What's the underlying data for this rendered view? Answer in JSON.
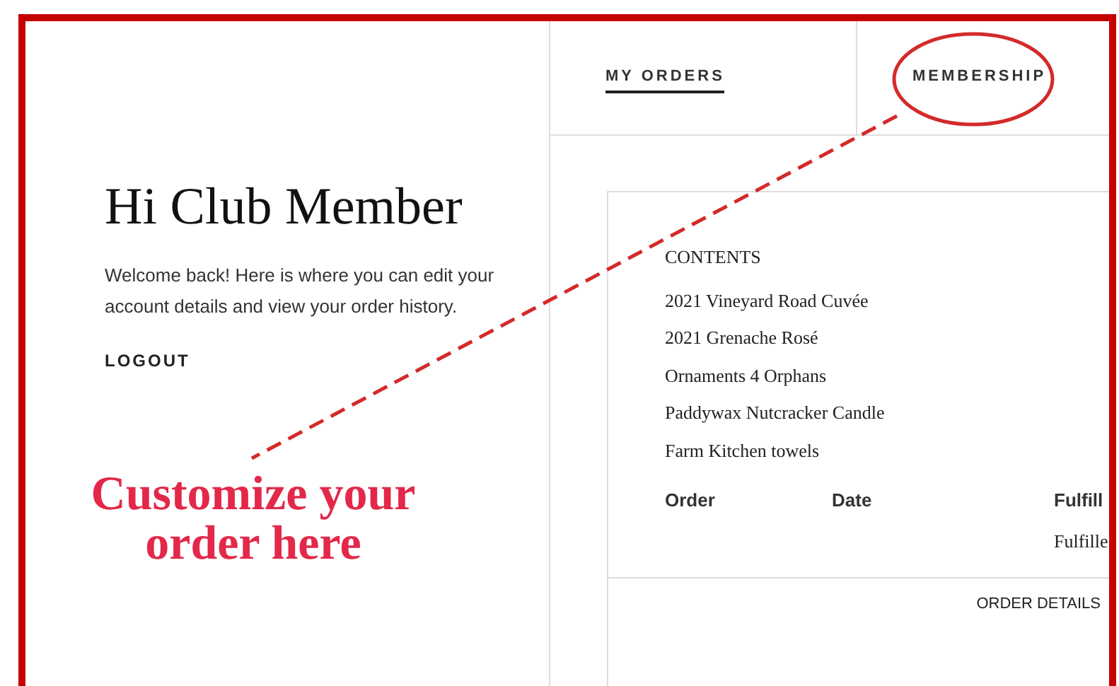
{
  "tabs": [
    {
      "label": "MY ORDERS",
      "selected": true
    },
    {
      "label": "MEMBERSHIP",
      "selected": false
    }
  ],
  "account": {
    "greeting": "Hi Club Member",
    "message": "Welcome back! Here is where you can edit your account details and view your order history.",
    "logout": "LOGOUT"
  },
  "order_card": {
    "contents_title": "CONTENTS",
    "contents": [
      "2021 Vineyard Road Cuvée",
      "2021 Grenache Rosé",
      "Ornaments 4 Orphans",
      "Paddywax Nutcracker Candle",
      "Farm Kitchen towels"
    ],
    "columns": [
      "Order",
      "Date",
      "Fulfill"
    ],
    "rows": [
      [
        "",
        "",
        "Fulfille"
      ]
    ],
    "details_link": "ORDER DETAILS"
  },
  "annotation": {
    "text": "Customize your order here"
  }
}
